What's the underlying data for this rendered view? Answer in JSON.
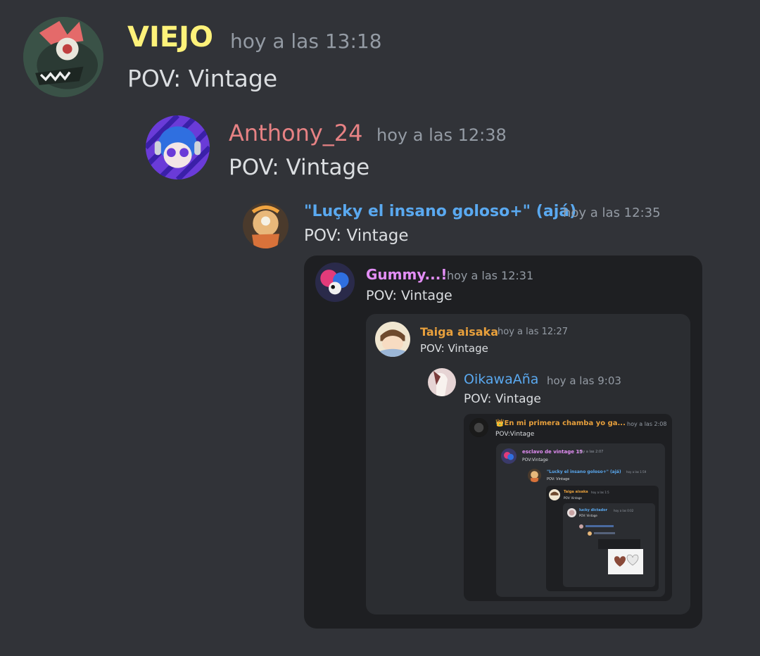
{
  "messages": [
    {
      "author": "VIEJO",
      "time": "hoy a las 13:18",
      "text": "POV: Vintage",
      "color": "#fef27a"
    },
    {
      "author": "Anthony_24",
      "time": "hoy a las 12:38",
      "text": "POV: Vintage",
      "color": "#e78284"
    },
    {
      "author": "\"Luçky el insano goloso+\" (ajá)",
      "time": "hoy a las 12:35",
      "text": "POV: Vintage",
      "color": "#5aa9f0"
    },
    {
      "author": "Gummy...!",
      "time": "hoy a las 12:31",
      "text": "POV: Vintage",
      "color": "#e38ef5"
    },
    {
      "author": "Taiga aisaka",
      "time": "hoy a las 12:27",
      "text": "POV: Vintage",
      "color": "#e8a03c"
    },
    {
      "author": "OikawaAña",
      "time": "hoy a las 9:03",
      "text": "POV: Vintage",
      "color": "#5aa9f0"
    },
    {
      "author": "👑En mi primera chamba yo ga...",
      "time": "hoy a las 2:08",
      "text": "POV:Vintage",
      "color": "#e8a03c"
    },
    {
      "author": "esclavo de vintage 15",
      "time": "hoy a las 2:07",
      "text": "POV:Vintage",
      "color": "#e38ef5"
    },
    {
      "author": "\"Lucky el insano goloso+\" (ajá)",
      "time": "hoy a las 1:59",
      "text": "POV: Vintage",
      "color": "#5aa9f0"
    },
    {
      "author": "Taiga aisaka",
      "time": "hoy a las 1:5",
      "text": "POV: Vintage",
      "color": "#e8a03c"
    },
    {
      "author": "lucky dictador",
      "time": "hoy a las 0:02",
      "text": "POV: Vintage",
      "color": "#5aa9f0"
    }
  ]
}
